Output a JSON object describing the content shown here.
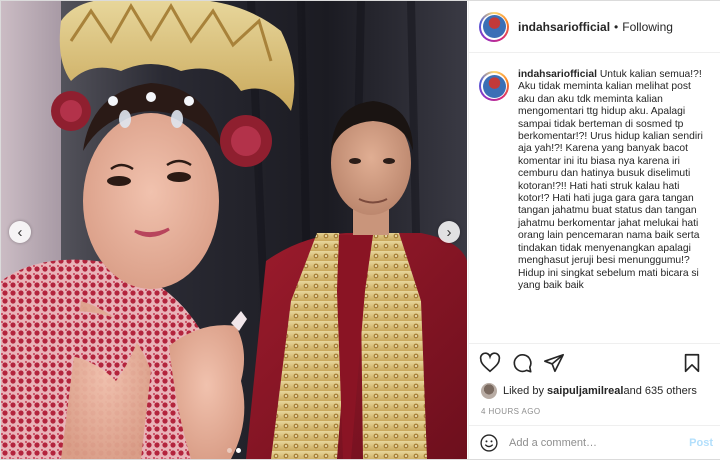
{
  "post": {
    "username": "indahsariofficial",
    "separator": "•",
    "follow_status": "Following",
    "more_icon": "more-icon",
    "caption": {
      "username": "indahsariofficial",
      "text": "Untuk kalian semua!?! Aku tidak meminta kalian melihat post aku dan aku tdk meminta kalian mengomentari ttg hidup aku. Apalagi sampai tidak berteman di sosmed tp berkomentar!?! Urus hidup kalian sendiri aja yah!?! Karena yang banyak bacot komentar ini itu biasa nya karena iri cemburu dan hatinya busuk diselimuti kotoran!?!! Hati hati struk kalau hati kotor!? Hati hati juga gara gara tangan tangan jahatmu buat status dan tangan jahatmu berkomentar jahat melukai hati orang lain pencemaran nama baik serta tindakan tidak menyenangkan apalagi menghasut jeruji besi menunggumu!? Hidup ini singkat sebelum mati bicara si yang baik baik"
    },
    "likes": {
      "prefix": "Liked by ",
      "user": "saipuljamilreal",
      "suffix": " and 635 others"
    },
    "timestamp": "4 HOURS AGO",
    "comment": {
      "placeholder": "Add a comment…",
      "post_label": "Post"
    },
    "carousel": {
      "prev": "‹",
      "next": "›",
      "slide_count": 2,
      "active_slide": 1
    }
  },
  "colors": {
    "text": "#262626",
    "muted": "#8e8e8e",
    "post_disabled": "#b2dffc",
    "border": "#efefef"
  }
}
